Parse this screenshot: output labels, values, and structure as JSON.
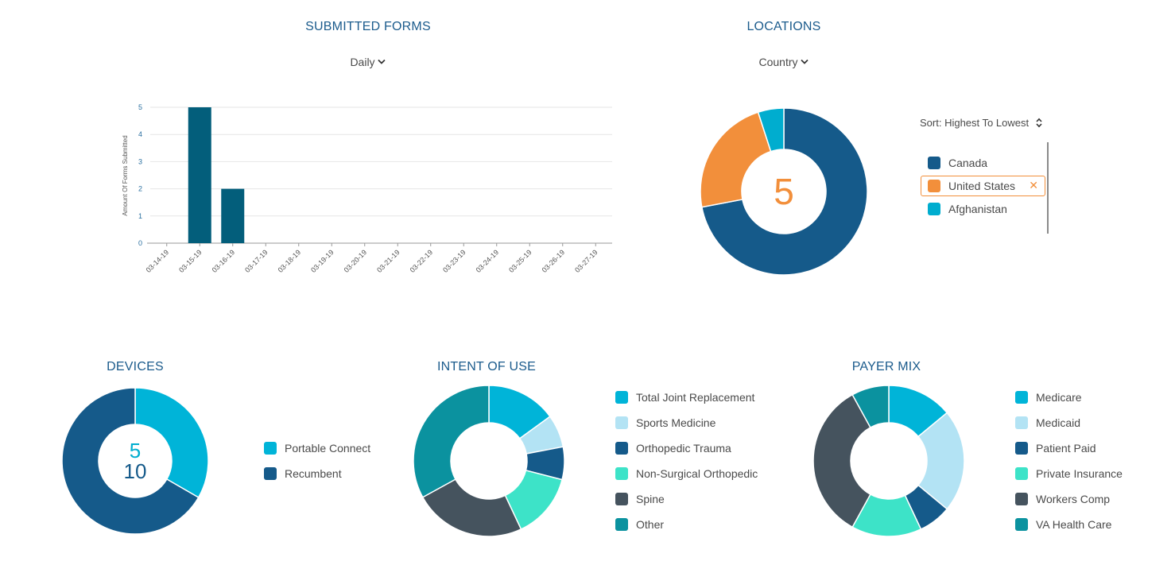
{
  "submitted_forms": {
    "title": "SUBMITTED FORMS",
    "dropdown_label": "Daily",
    "chart_data": {
      "type": "bar",
      "ylabel": "Amount Of Forms Submitted",
      "ylim": [
        0,
        5
      ],
      "yticks": [
        "0",
        "1",
        "2",
        "3",
        "4",
        "5"
      ],
      "grid": true,
      "categories": [
        "03-14-19",
        "03-15-19",
        "03-16-19",
        "03-17-19",
        "03-18-19",
        "03-19-19",
        "03-20-19",
        "03-21-19",
        "03-22-19",
        "03-23-19",
        "03-24-19",
        "03-25-19",
        "03-26-19",
        "03-27-19"
      ],
      "values": [
        0,
        5,
        2,
        0,
        0,
        0,
        0,
        0,
        0,
        0,
        0,
        0,
        0,
        0
      ],
      "color": "#035e7b"
    }
  },
  "locations": {
    "title": "LOCATIONS",
    "dropdown_label": "Country",
    "sort_label": "Sort: Highest To Lowest",
    "center_value": "5",
    "center_color": "#f28f3b",
    "chart_data": {
      "type": "pie",
      "labels": [
        "Canada",
        "United States",
        "Afghanistan"
      ],
      "values": [
        72,
        23,
        5
      ],
      "colors": [
        "#155a8a",
        "#f28f3b",
        "#00adcf"
      ],
      "selected": "United States"
    }
  },
  "devices": {
    "title": "DEVICES",
    "center_values": [
      "5",
      "10"
    ],
    "center_colors": [
      "#00adcf",
      "#155a8a"
    ],
    "chart_data": {
      "type": "pie",
      "labels": [
        "Portable Connect",
        "Recumbent"
      ],
      "values": [
        5,
        10
      ],
      "colors": [
        "#00b4d8",
        "#155a8a"
      ]
    }
  },
  "intent_of_use": {
    "title": "INTENT OF USE",
    "chart_data": {
      "type": "pie",
      "labels": [
        "Total Joint Replacement",
        "Sports Medicine",
        "Orthopedic Trauma",
        "Non-Surgical Orthopedic",
        "Spine",
        "Other"
      ],
      "values": [
        15,
        7,
        7,
        14,
        24,
        33
      ],
      "colors": [
        "#00b4d8",
        "#b3e3f4",
        "#155a8a",
        "#3de3c8",
        "#45535e",
        "#0b929f"
      ]
    }
  },
  "payer_mix": {
    "title": "PAYER MIX",
    "chart_data": {
      "type": "pie",
      "labels": [
        "Medicare",
        "Medicaid",
        "Patient Paid",
        "Private Insurance",
        "Workers Comp",
        "VA Health Care"
      ],
      "values": [
        14,
        22,
        7,
        15,
        34,
        8
      ],
      "colors": [
        "#00b4d8",
        "#b3e3f4",
        "#155a8a",
        "#3de3c8",
        "#45535e",
        "#0b929f"
      ]
    }
  }
}
